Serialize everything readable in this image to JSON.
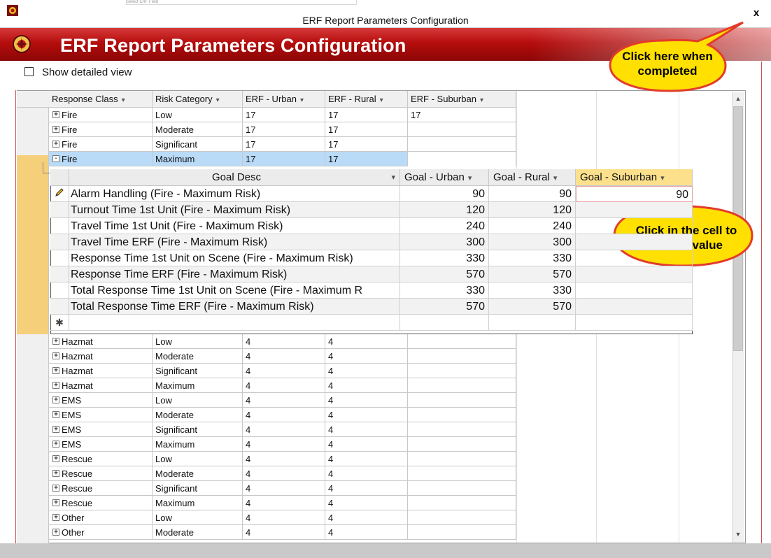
{
  "window": {
    "title": "ERF Report Parameters Configuration",
    "close_label": "x",
    "top_strip_text": "Select ERF Field"
  },
  "banner": {
    "title": "ERF Report Parameters Configuration"
  },
  "detail_toggle": {
    "label": "Show detailed view",
    "checked": false
  },
  "grid": {
    "columns": [
      "Response Class",
      "Risk Category",
      "ERF - Urban",
      "ERF - Rural",
      "ERF - Suburban"
    ],
    "rows": [
      {
        "response_class": "Fire",
        "risk": "Low",
        "urban": "17",
        "rural": "17",
        "suburban": "17",
        "expander": "+"
      },
      {
        "response_class": "Fire",
        "risk": "Moderate",
        "urban": "17",
        "rural": "17",
        "suburban": "",
        "expander": "+"
      },
      {
        "response_class": "Fire",
        "risk": "Significant",
        "urban": "17",
        "rural": "17",
        "suburban": "",
        "expander": "+"
      },
      {
        "response_class": "Fire",
        "risk": "Maximum",
        "urban": "17",
        "rural": "17",
        "suburban": "",
        "expander": "-"
      },
      {
        "response_class": "Hazmat",
        "risk": "Low",
        "urban": "4",
        "rural": "4",
        "suburban": "",
        "expander": "+"
      },
      {
        "response_class": "Hazmat",
        "risk": "Moderate",
        "urban": "4",
        "rural": "4",
        "suburban": "",
        "expander": "+"
      },
      {
        "response_class": "Hazmat",
        "risk": "Significant",
        "urban": "4",
        "rural": "4",
        "suburban": "",
        "expander": "+"
      },
      {
        "response_class": "Hazmat",
        "risk": "Maximum",
        "urban": "4",
        "rural": "4",
        "suburban": "",
        "expander": "+"
      },
      {
        "response_class": "EMS",
        "risk": "Low",
        "urban": "4",
        "rural": "4",
        "suburban": "",
        "expander": "+"
      },
      {
        "response_class": "EMS",
        "risk": "Moderate",
        "urban": "4",
        "rural": "4",
        "suburban": "",
        "expander": "+"
      },
      {
        "response_class": "EMS",
        "risk": "Significant",
        "urban": "4",
        "rural": "4",
        "suburban": "",
        "expander": "+"
      },
      {
        "response_class": "EMS",
        "risk": "Maximum",
        "urban": "4",
        "rural": "4",
        "suburban": "",
        "expander": "+"
      },
      {
        "response_class": "Rescue",
        "risk": "Low",
        "urban": "4",
        "rural": "4",
        "suburban": "",
        "expander": "+"
      },
      {
        "response_class": "Rescue",
        "risk": "Moderate",
        "urban": "4",
        "rural": "4",
        "suburban": "",
        "expander": "+"
      },
      {
        "response_class": "Rescue",
        "risk": "Significant",
        "urban": "4",
        "rural": "4",
        "suburban": "",
        "expander": "+"
      },
      {
        "response_class": "Rescue",
        "risk": "Maximum",
        "urban": "4",
        "rural": "4",
        "suburban": "",
        "expander": "+"
      },
      {
        "response_class": "Other",
        "risk": "Low",
        "urban": "4",
        "rural": "4",
        "suburban": "",
        "expander": "+"
      },
      {
        "response_class": "Other",
        "risk": "Moderate",
        "urban": "4",
        "rural": "4",
        "suburban": "",
        "expander": "+"
      }
    ]
  },
  "subdatasheet": {
    "columns": [
      "Goal Desc",
      "Goal - Urban",
      "Goal - Rural",
      "Goal - Suburban"
    ],
    "rows": [
      {
        "desc": "Alarm Handling (Fire - Maximum Risk)",
        "urban": "90",
        "rural": "90",
        "suburban": "90",
        "marker": "edit-pencil"
      },
      {
        "desc": "Turnout Time 1st Unit (Fire - Maximum Risk)",
        "urban": "120",
        "rural": "120",
        "suburban": ""
      },
      {
        "desc": "Travel Time 1st Unit (Fire - Maximum Risk)",
        "urban": "240",
        "rural": "240",
        "suburban": ""
      },
      {
        "desc": "Travel Time ERF (Fire - Maximum Risk)",
        "urban": "300",
        "rural": "300",
        "suburban": ""
      },
      {
        "desc": "Response Time 1st Unit on Scene (Fire - Maximum Risk)",
        "urban": "330",
        "rural": "330",
        "suburban": ""
      },
      {
        "desc": "Response Time ERF (Fire - Maximum Risk)",
        "urban": "570",
        "rural": "570",
        "suburban": ""
      },
      {
        "desc": "Total Response Time 1st Unit on Scene (Fire - Maximum R",
        "urban": "330",
        "rural": "330",
        "suburban": ""
      },
      {
        "desc": "Total Response Time ERF (Fire - Maximum Risk)",
        "urban": "570",
        "rural": "570",
        "suburban": ""
      },
      {
        "desc": "",
        "urban": "",
        "rural": "",
        "suburban": "",
        "marker": "new-record"
      }
    ],
    "new_record_symbol": "✱"
  },
  "callouts": {
    "completed": {
      "line1": "Click here when",
      "line2": "completed"
    },
    "enter_value": {
      "line1": "Click in the cell to",
      "line2": "enter a value"
    }
  },
  "colors": {
    "banner_red": "#b50d0d",
    "selection_blue": "#b9dbf8",
    "active_header_yellow": "#fce08c",
    "row_selector_orange": "#f6cf7a",
    "callout_yellow": "#ffe000",
    "callout_stroke": "#e33b2b"
  }
}
